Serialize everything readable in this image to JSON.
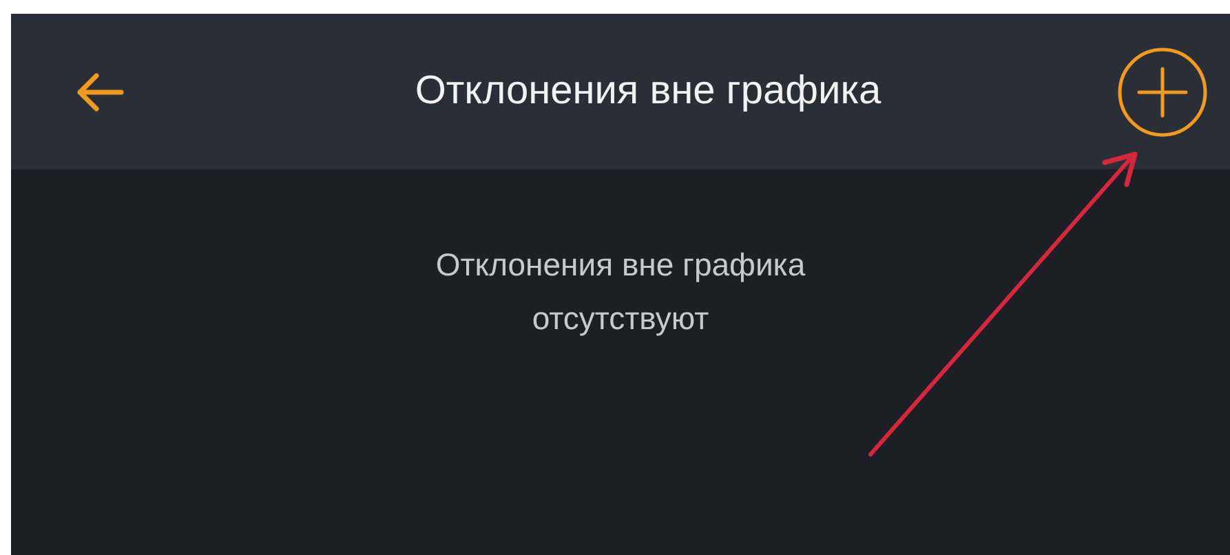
{
  "header": {
    "title": "Отклонения вне графика"
  },
  "empty_state": {
    "message": "Отклонения вне графика отсутствуют"
  }
}
